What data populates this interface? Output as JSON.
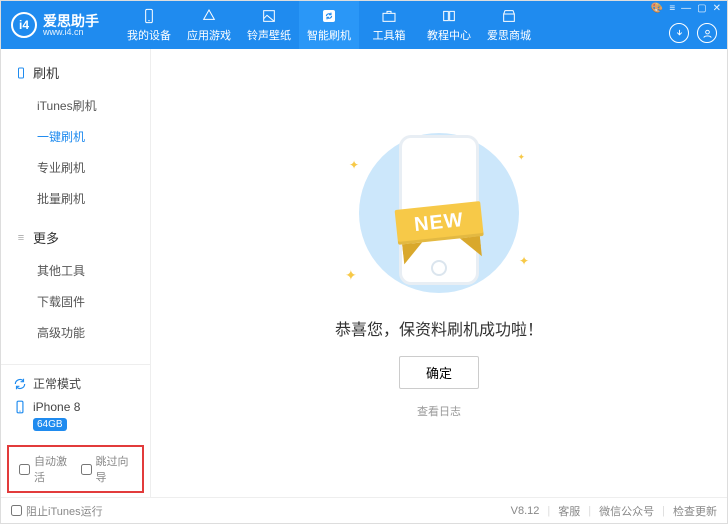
{
  "brand": {
    "logo_text": "i4",
    "title": "爱思助手",
    "url": "www.i4.cn"
  },
  "nav": {
    "items": [
      {
        "label": "我的设备"
      },
      {
        "label": "应用游戏"
      },
      {
        "label": "铃声壁纸"
      },
      {
        "label": "智能刷机"
      },
      {
        "label": "工具箱"
      },
      {
        "label": "教程中心"
      },
      {
        "label": "爱思商城"
      }
    ],
    "active_index": 3
  },
  "window_controls": {
    "skin": "🎨",
    "menu": "≡",
    "min": "—",
    "max": "▢",
    "close": "✕"
  },
  "sidebar": {
    "sections": [
      {
        "title": "刷机",
        "items": [
          "iTunes刷机",
          "一键刷机",
          "专业刷机",
          "批量刷机"
        ],
        "active_index": 1
      },
      {
        "title": "更多",
        "items": [
          "其他工具",
          "下载固件",
          "高级功能"
        ],
        "active_index": -1
      }
    ],
    "mode": {
      "label": "正常模式"
    },
    "device": {
      "name": "iPhone 8",
      "storage": "64GB"
    },
    "options": {
      "auto_activate": "自动激活",
      "skip_guide": "跳过向导"
    }
  },
  "main": {
    "ribbon": "NEW",
    "message": "恭喜您，保资料刷机成功啦！",
    "confirm": "确定",
    "view_log": "查看日志"
  },
  "footer": {
    "block_itunes": "阻止iTunes运行",
    "version": "V8.12",
    "links": [
      "客服",
      "微信公众号",
      "检查更新"
    ]
  }
}
